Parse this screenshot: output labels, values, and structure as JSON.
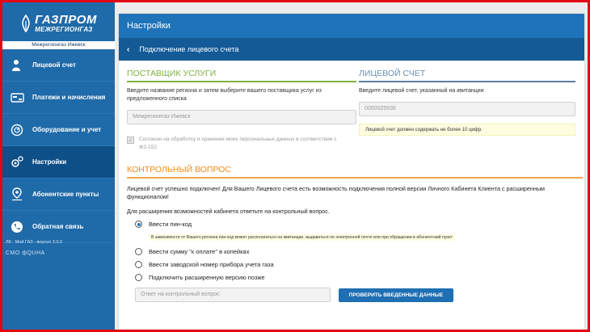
{
  "brand": {
    "name": "ГАЗПРОМ",
    "subname": "МЕЖРЕГИОНГАЗ",
    "company": "Межрегионгаз Ижевск",
    "color": "#1f6aa8"
  },
  "nav": {
    "items": [
      {
        "label": "Лицевой счет",
        "icon": "user-icon"
      },
      {
        "label": "Платежи и начисления",
        "icon": "card-icon"
      },
      {
        "label": "Оборудование и учет",
        "icon": "meter-icon"
      },
      {
        "label": "Настройки",
        "icon": "gear-icon",
        "active": true
      },
      {
        "label": "Абонентские пункты",
        "icon": "map-pin-icon"
      },
      {
        "label": "Обратная связь",
        "icon": "phone-icon"
      }
    ]
  },
  "version": "ЛК - Мой ГАЗ - версия 3.0.0",
  "developer": "СМО фQUHA",
  "header": {
    "title": "Настройки",
    "subtitle": "Подключение лицевого счета",
    "back": "‹"
  },
  "provider": {
    "title": "ПОСТАВЩИК УСЛУГИ",
    "instruction": "Введите название региона и затем выберите вашего поставщика услуг из предложенного списка",
    "value": "Межрегионгаз Ижевск",
    "consent": "Согласен на обработку и хранение моих персональных данных в соответствии с ФЗ-152."
  },
  "account": {
    "title": "ЛИЦЕВОЙ СЧЕТ",
    "instruction": "Введите лицевой счет, указанный на квитанции",
    "value": "0050025936",
    "note": "Лицевой счет должен содержать не более 10 цифр."
  },
  "control": {
    "title": "КОНТРОЛЬНЫЙ ВОПРОС",
    "message": "Лицевой счет успешно подключен! Для Вашего Лицевого счета есть возможность подключения полной версии Личного Кабинета Клиента с расширенным функционалом!",
    "ask": "Для расширения возможностей кабинета ответьте на контрольный вопрос.",
    "options": [
      {
        "label": "Ввести пин-код",
        "selected": true
      },
      {
        "label": "Ввести сумму \"к оплате\" в копейках",
        "selected": false
      },
      {
        "label": "Ввести заводской номер прибора учета газа",
        "selected": false
      },
      {
        "label": "Подключить расширенную версию позже",
        "selected": false
      }
    ],
    "hint": "В зависимости от Вашего региона пин-код может располагаться на квитанции, выдаваться по электронной почте или при обращении в абонентский пункт",
    "answer_placeholder": "Ответ на контрольный вопрос",
    "submit": "ПРОВЕРИТЬ ВВЕДЕННЫЕ ДАННЫЕ"
  }
}
